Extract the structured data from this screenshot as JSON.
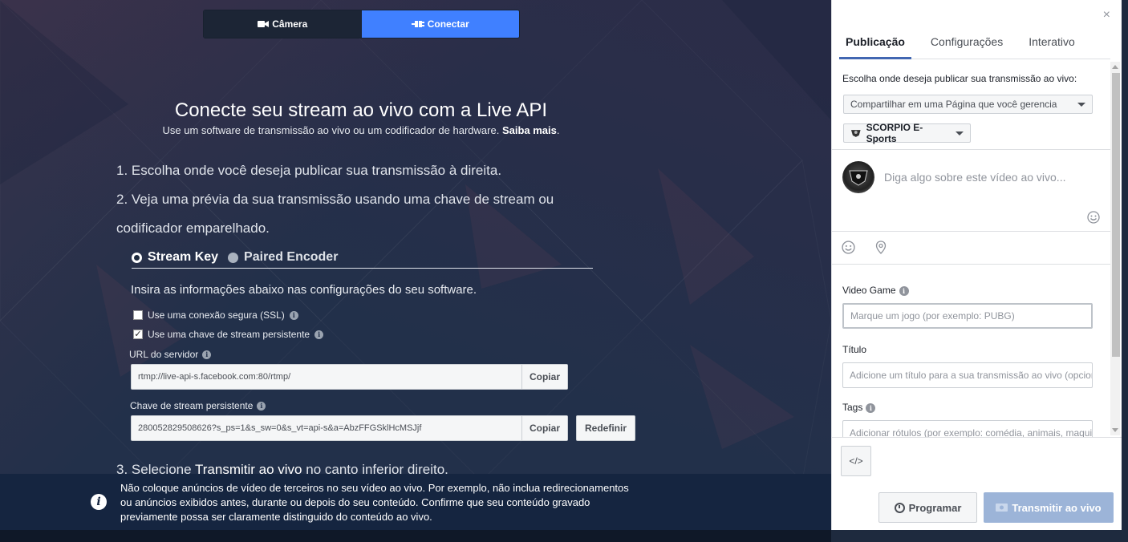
{
  "top_tabs": {
    "camera_label": "Câmera",
    "connect_label": "Conectar"
  },
  "main": {
    "title": "Conecte seu stream ao vivo com a Live API",
    "subtitle": "Use um software de transmissão ao vivo ou um codificador de hardware.",
    "learn_more": "Saiba mais",
    "step1": "1. Escolha onde você deseja publicar sua transmissão à direita.",
    "step2": "2. Veja uma prévia da sua transmissão usando uma chave de stream ou codificador emparelhado.",
    "mode_stream_key": "Stream Key",
    "mode_paired_encoder": "Paired Encoder",
    "instructions": "Insira as informações abaixo nas configurações do seu software.",
    "ssl_label": "Use uma conexão segura (SSL)",
    "persistent_label": "Use uma chave de stream persistente",
    "server_url_label": "URL do servidor",
    "server_url_value": "rtmp://live-api-s.facebook.com:80/rtmp/",
    "stream_key_label": "Chave de stream persistente",
    "stream_key_value": "280052829508626?s_ps=1&s_sw=0&s_vt=api-s&a=AbzFFGSklHcMSJjf",
    "copy_label": "Copiar",
    "reset_label": "Redefinir",
    "step3_prefix": "3. Selecione",
    "step3_bold": "Transmitir ao vivo",
    "step3_suffix": "no canto inferior direito."
  },
  "notice": {
    "text": "Não coloque anúncios de vídeo de terceiros no seu vídeo ao vivo. Por exemplo, não inclua redirecionamentos ou anúncios exibidos antes, durante ou depois do seu conteúdo. Confirme que seu conteúdo gravado previamente possa ser claramente distinguido do conteúdo ao vivo."
  },
  "panel": {
    "close_glyph": "×",
    "tabs": [
      "Publicação",
      "Configurações",
      "Interativo"
    ],
    "publish_label": "Escolha onde deseja publicar sua transmissão ao vivo:",
    "publish_select": "Compartilhar em uma Página que você gerencia",
    "page_select": "SCORPIO E-Sports",
    "say_placeholder": "Diga algo sobre este vídeo ao vivo...",
    "video_game_label": "Video Game",
    "video_game_placeholder": "Marque um jogo (por exemplo: PUBG)",
    "title_label": "Título",
    "title_placeholder": "Adicione um título para a sua transmissão ao vivo (opcional)",
    "tags_label": "Tags",
    "tags_placeholder": "Adicionar rótulos (por exemplo: comédia, animais, maquiagem)",
    "embed_glyph": "</>",
    "schedule_label": "Programar",
    "go_live_label": "Transmitir ao vivo"
  }
}
